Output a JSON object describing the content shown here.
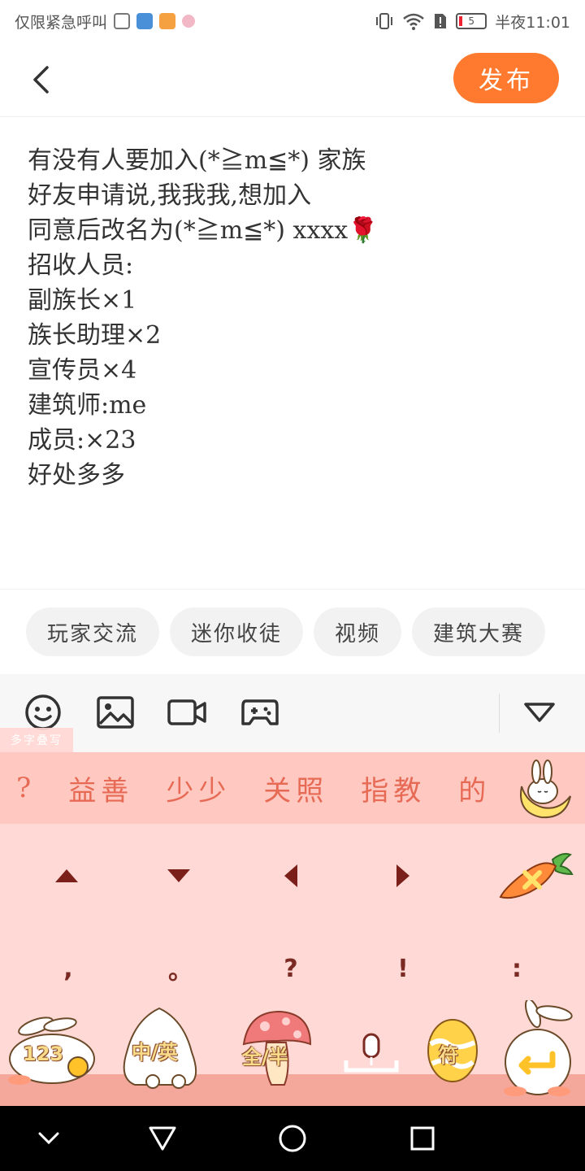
{
  "status_bar": {
    "carrier": "仅限紧急呼叫",
    "time": "半夜11:01",
    "battery": "5"
  },
  "header": {
    "publish_label": "发布"
  },
  "post": {
    "lines": [
      "有没有人要加入(*≧m≦*) 家族",
      "好友申请说,我我我,想加入",
      "同意后改名为(*≧m≦*) xxxx🌹",
      "招收人员:",
      "副族长×1",
      "族长助理×2",
      "宣传员×4",
      "建筑师:me",
      "成员:×23",
      "好处多多"
    ]
  },
  "tags": [
    "玩家交流",
    "迷你收徒",
    "视频",
    "建筑大赛"
  ],
  "toolbar": {
    "icons": [
      "emoji-icon",
      "image-icon",
      "video-icon",
      "gamepad-icon",
      "collapse-icon"
    ],
    "handwrite_label": "多字叠写"
  },
  "keyboard": {
    "candidates": [
      "?",
      "益善",
      "少少",
      "关照",
      "指教",
      "的"
    ],
    "punctuation": [
      ",",
      "。",
      "?",
      "!",
      ":"
    ],
    "keys": {
      "numbers": "123",
      "lang": "中/英",
      "width": "全/半",
      "symbols": "符"
    },
    "colors": {
      "accent": "#ff7a2e",
      "keyboard_bg": "#ffd9d5",
      "candidate_text": "#e76a55"
    }
  }
}
